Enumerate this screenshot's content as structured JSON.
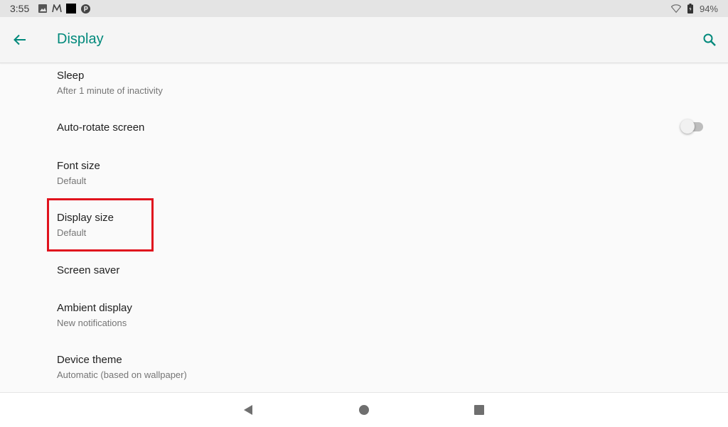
{
  "status_bar": {
    "time": "3:55",
    "battery_percent": "94%",
    "icons": [
      "image-icon",
      "notification-m-icon",
      "black-square-icon",
      "p-circle-icon",
      "wifi-icon",
      "battery-icon"
    ]
  },
  "app_bar": {
    "title": "Display",
    "back_icon": "arrow-back-icon",
    "search_icon": "search-icon",
    "accent_color": "#00897b"
  },
  "settings": [
    {
      "title": "Sleep",
      "summary": "After 1 minute of inactivity"
    },
    {
      "title": "Auto-rotate screen",
      "toggle": false
    },
    {
      "title": "Font size",
      "summary": "Default"
    },
    {
      "title": "Display size",
      "summary": "Default",
      "highlighted": true
    },
    {
      "title": "Screen saver"
    },
    {
      "title": "Ambient display",
      "summary": "New notifications"
    },
    {
      "title": "Device theme",
      "summary": "Automatic (based on wallpaper)"
    }
  ],
  "nav_bar": {
    "buttons": [
      "back-triangle-icon",
      "home-circle-icon",
      "recents-square-icon"
    ]
  },
  "colors": {
    "highlight": "#e0121d",
    "background": "#fafafa"
  }
}
